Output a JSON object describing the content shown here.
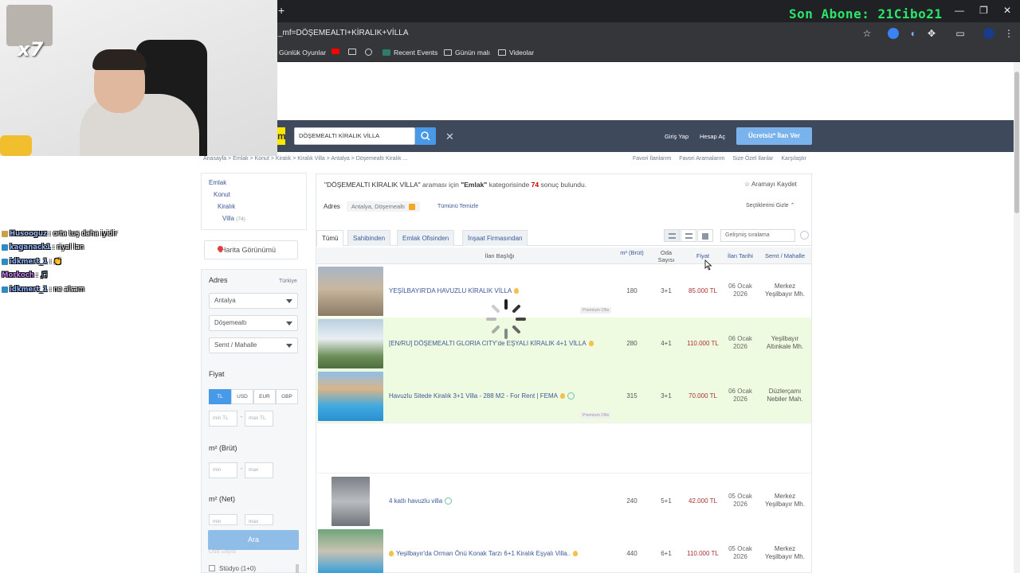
{
  "stream": {
    "subscriber_banner": "Son Abone: 21Cibo21",
    "overlay_multiplier": "x7",
    "chat": [
      {
        "user": "Husooguz",
        "message": ": orta tuş daha iyidir"
      },
      {
        "user": "kaganack1",
        "message": ": riyal lan"
      },
      {
        "user": "idkmert_1",
        "message": ": 👏"
      },
      {
        "user": "Morkoch",
        "message": ": 🎵"
      },
      {
        "user": "idkmert_1",
        "message": ": ne alsam"
      }
    ]
  },
  "browser": {
    "url_fragment": "_mf=DÖŞEMEALTI+KİRALIK+VİLLA",
    "bookmarks": [
      "Günlük Oyunlar",
      "Recent Events",
      "Günün malı",
      "Videolar"
    ],
    "window_controls": [
      "—",
      "❐",
      "✕"
    ]
  },
  "header": {
    "logo": "m",
    "search_value": "DÖŞEMEALTI KİRALIK VİLLA",
    "login": "Giriş Yap",
    "register": "Hesap Aç",
    "post_ad": "Ücretsiz* İlan Ver"
  },
  "breadcrumb": "Anasayfa  >  Emlak  >  Konut  >  Kiralık  >  Kiralık Villa  >  Antalya  >  Döşemealtı Kiralık ...",
  "top_links": [
    "Favori İlanlarım",
    "Favori Aramalarım",
    "Size Özel İlanlar",
    "Karşılaştır"
  ],
  "sidebar": {
    "categories": [
      {
        "label": "Emlak"
      },
      {
        "label": "Konut"
      },
      {
        "label": "Kiralık"
      },
      {
        "label": "Villa",
        "count": "(74)"
      }
    ],
    "map_button": "Harita Görünümü",
    "adres_label": "Adres",
    "country_link": "Türkiye",
    "city": "Antalya",
    "district": "Döşemealtı",
    "neighborhood": "Semt / Mahalle",
    "price_label": "Fiyat",
    "currencies": [
      "TL",
      "USD",
      "EUR",
      "GBP"
    ],
    "min_tl": "min TL",
    "max_tl": "max TL",
    "m2_brut_label": "m² (Brüt)",
    "m2_net_label": "m² (Net)",
    "min": "min",
    "max": "max",
    "search_button": "Ara",
    "faded_label": "Oda Sayısı",
    "room_option": "Stüdyo (1+0)"
  },
  "results": {
    "query": "\"DÖŞEMEALTI KİRALIK VİLLA\"",
    "summary_mid": " araması için ",
    "category": "\"Emlak\"",
    "summary_tail": " kategorisinde ",
    "count": "74",
    "summary_end": " sonuç bulundu.",
    "save_search": "☆ Aramayı Kaydet",
    "adres_label": "Adres",
    "adres_chip": "Antalya, Döşemealtı",
    "clear_all": "Tümünü Temizle",
    "hide_selected": "Seçtiklerimi Gizle ⌃",
    "tabs": [
      "Tümü",
      "Sahibinden",
      "Emlak Ofisinden",
      "İnşaat Firmasından"
    ],
    "sort_placeholder": "Gelişmiş sıralama",
    "columns": {
      "title": "İlan Başlığı",
      "m2": "m² (Brüt)",
      "rooms": "Oda Sayısı",
      "price": "Fiyat",
      "date": "İlan Tarihi",
      "location": "Semt / Mahalle"
    },
    "premium_label": "Premium Ofis",
    "listings": [
      {
        "title": "YEŞİLBAYIR'DA HAVUZLU KİRALIK VİLLA",
        "m2": "180",
        "rooms": "3+1",
        "price": "85.000 TL",
        "date_day": "06 Ocak",
        "date_year": "2026",
        "loc1": "Merkez",
        "loc2": "Yeşilbayır Mh."
      },
      {
        "title": "[EN/RU] DÖŞEMEALTI GLORIA CITY'de EŞYALI KİRALIK 4+1 VİLLA",
        "m2": "280",
        "rooms": "4+1",
        "price": "110.000 TL",
        "date_day": "06 Ocak",
        "date_year": "2026",
        "loc1": "Yeşilbayır",
        "loc2": "Altınkale Mh."
      },
      {
        "title": "Havuzlu Sitede Kiralık 3+1 Villa - 288 M2 - For Rent | FEMA",
        "m2": "315",
        "rooms": "3+1",
        "price": "70.000 TL",
        "date_day": "06 Ocak",
        "date_year": "2026",
        "loc1": "Düzlerçamı",
        "loc2": "Nebiler Mah."
      },
      {
        "title": "4 katlı havuzlu villa",
        "m2": "240",
        "rooms": "5+1",
        "price": "42.000 TL",
        "date_day": "05 Ocak",
        "date_year": "2026",
        "loc1": "Merkez",
        "loc2": "Yeşilbayır Mh."
      },
      {
        "title": "Yeşilbayır'da Orman Önü Konak Tarzı 6+1 Kiralık Eşyalı Villa..",
        "m2": "440",
        "rooms": "6+1",
        "price": "110.000 TL",
        "date_day": "05 Ocak",
        "date_year": "2026",
        "loc1": "Merkez",
        "loc2": "Yeşilbayır Mh."
      }
    ]
  }
}
